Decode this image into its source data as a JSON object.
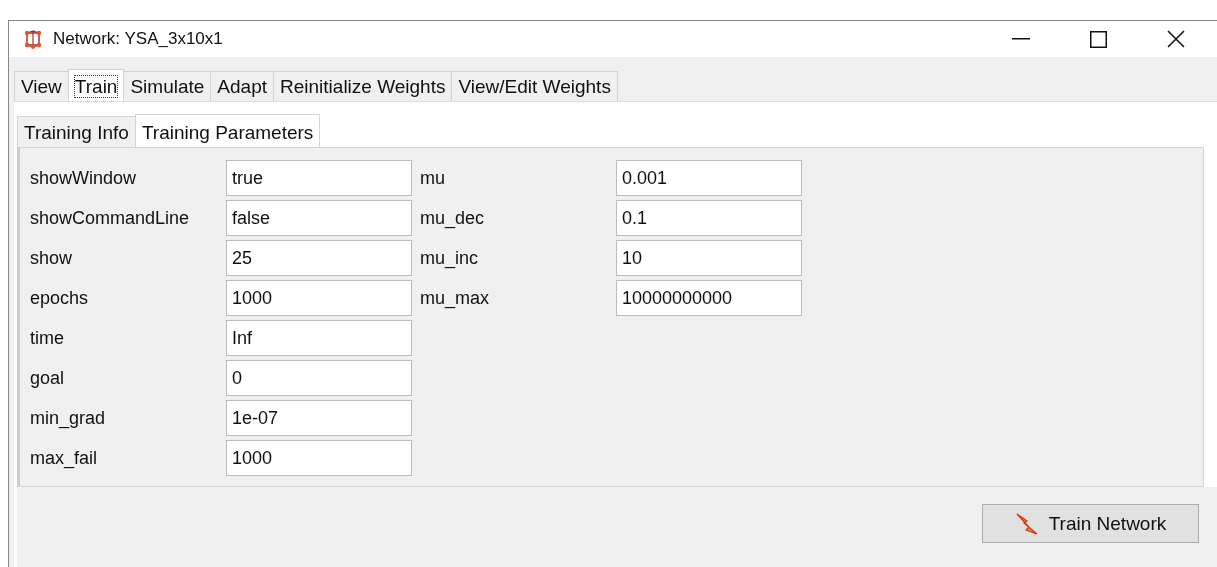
{
  "window": {
    "title": "Network: YSA_3x10x1"
  },
  "tabs": [
    {
      "label": "View",
      "selected": false
    },
    {
      "label": "Train",
      "selected": true
    },
    {
      "label": "Simulate",
      "selected": false
    },
    {
      "label": "Adapt",
      "selected": false
    },
    {
      "label": "Reinitialize Weights",
      "selected": false
    },
    {
      "label": "View/Edit Weights",
      "selected": false
    }
  ],
  "subtabs": [
    {
      "label": "Training Info",
      "selected": false
    },
    {
      "label": "Training Parameters",
      "selected": true
    }
  ],
  "parameter_columns": [
    [
      {
        "name": "showWindow",
        "value": "true"
      },
      {
        "name": "showCommandLine",
        "value": "false"
      },
      {
        "name": "show",
        "value": "25"
      },
      {
        "name": "epochs",
        "value": "1000"
      },
      {
        "name": "time",
        "value": "Inf"
      },
      {
        "name": "goal",
        "value": "0"
      },
      {
        "name": "min_grad",
        "value": "1e-07"
      },
      {
        "name": "max_fail",
        "value": "1000"
      }
    ],
    [
      {
        "name": "mu",
        "value": "0.001"
      },
      {
        "name": "mu_dec",
        "value": "0.1"
      },
      {
        "name": "mu_inc",
        "value": "10"
      },
      {
        "name": "mu_max",
        "value": "10000000000"
      }
    ]
  ],
  "train_button": {
    "label": "Train Network"
  }
}
